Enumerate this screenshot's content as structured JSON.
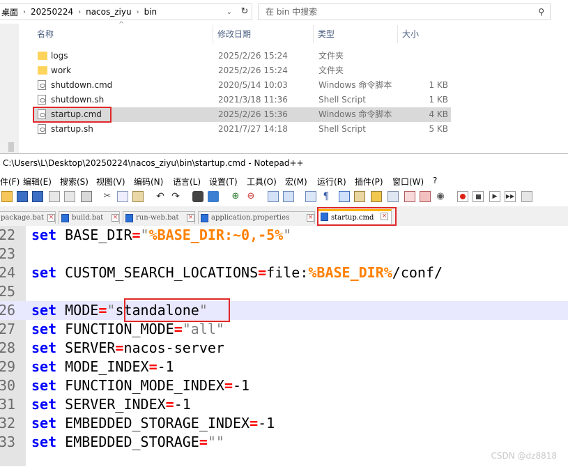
{
  "explorer": {
    "breadcrumb": [
      "桌面",
      "20250224",
      "nacos_ziyu",
      "bin"
    ],
    "search_placeholder": "在 bin 中搜索",
    "columns": {
      "name": "名称",
      "date": "修改日期",
      "type": "类型",
      "size": "大小"
    },
    "files": [
      {
        "name": "logs",
        "date": "2025/2/26 15:24",
        "type": "文件夹",
        "size": "",
        "icon": "folder-icon"
      },
      {
        "name": "work",
        "date": "2025/2/26 15:24",
        "type": "文件夹",
        "size": "",
        "icon": "folder-icon"
      },
      {
        "name": "shutdown.cmd",
        "date": "2020/5/14 10:03",
        "type": "Windows 命令脚本",
        "size": "1 KB",
        "icon": "script-file-icon"
      },
      {
        "name": "shutdown.sh",
        "date": "2021/3/18 11:36",
        "type": "Shell Script",
        "size": "1 KB",
        "icon": "script-file-icon"
      },
      {
        "name": "startup.cmd",
        "date": "2025/2/26 15:36",
        "type": "Windows 命令脚本",
        "size": "4 KB",
        "icon": "script-file-icon",
        "selected": true
      },
      {
        "name": "startup.sh",
        "date": "2021/7/27 14:18",
        "type": "Shell Script",
        "size": "5 KB",
        "icon": "script-file-icon"
      }
    ]
  },
  "notepad": {
    "title": "C:\\Users\\L\\Desktop\\20250224\\nacos_ziyu\\bin\\startup.cmd - Notepad++",
    "menu": [
      "件(F)",
      "编辑(E)",
      "搜索(S)",
      "视图(V)",
      "编码(N)",
      "语言(L)",
      "设置(T)",
      "工具(O)",
      "宏(M)",
      "运行(R)",
      "插件(P)",
      "窗口(W)",
      "?"
    ],
    "tabs": [
      {
        "label": "package.bat",
        "active": false
      },
      {
        "label": "build.bat",
        "active": false
      },
      {
        "label": "run-web.bat",
        "active": false
      },
      {
        "label": "application.properties",
        "active": false
      },
      {
        "label": "startup.cmd",
        "active": true
      }
    ],
    "lines": [
      {
        "num": "22",
        "parts": [
          [
            "kw",
            "set"
          ],
          [
            "plain",
            " BASE_DIR"
          ],
          [
            "op",
            "="
          ],
          [
            "str",
            "\""
          ],
          [
            "var",
            "%BASE_DIR:~0,-5%"
          ],
          [
            "str",
            "\""
          ]
        ]
      },
      {
        "num": "23",
        "parts": []
      },
      {
        "num": "24",
        "parts": [
          [
            "kw",
            "set"
          ],
          [
            "plain",
            " CUSTOM_SEARCH_LOCATIONS"
          ],
          [
            "op",
            "="
          ],
          [
            "plain",
            "file:"
          ],
          [
            "var",
            "%BASE_DIR%"
          ],
          [
            "plain",
            "/conf/"
          ]
        ]
      },
      {
        "num": "25",
        "parts": []
      },
      {
        "num": "26",
        "current": true,
        "parts": [
          [
            "kw",
            "set"
          ],
          [
            "plain",
            " MODE"
          ],
          [
            "op",
            "="
          ],
          [
            "str",
            "\""
          ],
          [
            "plain",
            "standalone"
          ],
          [
            "str",
            "\""
          ]
        ]
      },
      {
        "num": "27",
        "parts": [
          [
            "kw",
            "set"
          ],
          [
            "plain",
            " FUNCTION_MODE"
          ],
          [
            "op",
            "="
          ],
          [
            "str",
            "\"all\""
          ]
        ]
      },
      {
        "num": "28",
        "parts": [
          [
            "kw",
            "set"
          ],
          [
            "plain",
            " SERVER"
          ],
          [
            "op",
            "="
          ],
          [
            "plain",
            "nacos-server"
          ]
        ]
      },
      {
        "num": "29",
        "parts": [
          [
            "kw",
            "set"
          ],
          [
            "plain",
            " MODE_INDEX"
          ],
          [
            "op",
            "="
          ],
          [
            "plain",
            "-1"
          ]
        ]
      },
      {
        "num": "30",
        "parts": [
          [
            "kw",
            "set"
          ],
          [
            "plain",
            " FUNCTION_MODE_INDEX"
          ],
          [
            "op",
            "="
          ],
          [
            "plain",
            "-1"
          ]
        ]
      },
      {
        "num": "31",
        "parts": [
          [
            "kw",
            "set"
          ],
          [
            "plain",
            " SERVER_INDEX"
          ],
          [
            "op",
            "="
          ],
          [
            "plain",
            "-1"
          ]
        ]
      },
      {
        "num": "32",
        "parts": [
          [
            "kw",
            "set"
          ],
          [
            "plain",
            " EMBEDDED_STORAGE_INDEX"
          ],
          [
            "op",
            "="
          ],
          [
            "plain",
            "-1"
          ]
        ]
      },
      {
        "num": "33",
        "parts": [
          [
            "kw",
            "set"
          ],
          [
            "plain",
            " EMBEDDED_STORAGE"
          ],
          [
            "op",
            "="
          ],
          [
            "str",
            "\"\""
          ]
        ]
      }
    ]
  },
  "watermark": "CSDN @dz8818",
  "colors": {
    "keyword": "#0000ff",
    "operator": "#ff0000",
    "variable": "#ff8000",
    "highlight_box": "#e0282a",
    "current_line": "#e8e8ff"
  }
}
